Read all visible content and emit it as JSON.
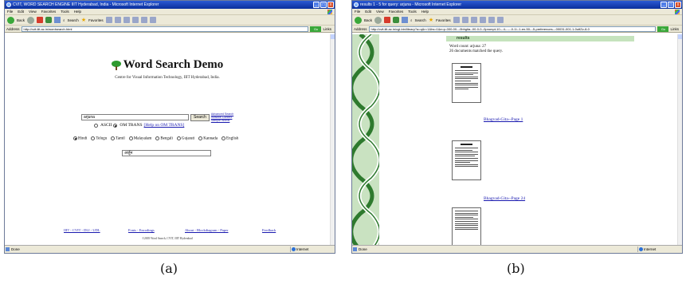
{
  "window_a": {
    "title": "CVIT, WORD SEARCH ENGINE IIIT Hyderabad, India - Microsoft Internet Explorer",
    "menu": [
      "File",
      "Edit",
      "View",
      "Favorites",
      "Tools",
      "Help"
    ],
    "toolbar": {
      "back": "Back",
      "search": "Search",
      "favorites": "Favorites"
    },
    "address_label": "Address",
    "address": "http://cvit.iiit.ac.in/wordsearch.html",
    "go": "Go",
    "links": "Links",
    "page": {
      "title": "Word Search Demo",
      "subtitle": "Centre for Visual Information Technology, IIIT Hyderabad, India.",
      "query_value": "arjuna",
      "search_button": "Search",
      "side_links": [
        "Advanced Search",
        "Invisible Content",
        "Sample Words"
      ],
      "encoding_options": [
        "ASCII",
        "OM TRANS"
      ],
      "encoding_selected": "OM TRANS",
      "help_link": "[Help on OM TRANS]",
      "languages": [
        "Hindi",
        "Telugu",
        "Tamil",
        "Malayalam",
        "Bengali",
        "Gujarati",
        "Kannada",
        "English"
      ],
      "language_selected": "Hindi",
      "transliterated_value": "अर्जुन",
      "footer_links": {
        "group1": "IIIT - CVIT - DLI - UDL",
        "group2": "Fonts - Encodings",
        "group3": "About - Blockdiagram - Paper",
        "group4": "Feedback"
      },
      "copyright": "©2005 Word Search, CVIT, IIIT Hyderabad"
    },
    "status": "Done",
    "zone": "Internet"
  },
  "window_b": {
    "title": "results 1 - 5 for query: arjuna - Microsoft Internet Explorer",
    "menu": [
      "File",
      "Edit",
      "View",
      "Favorites",
      "Tools",
      "Help"
    ],
    "toolbar": {
      "back": "Back",
      "search": "Search",
      "favorites": "Favorites"
    },
    "address_label": "Address",
    "address": "http://cvit.iiit.ac.in/cgi-bin/library?a=q&r=1&hs=1&e=p-000-00---0bhgita--00-0-0--0prompt-10---4------0-1l--1-en-50---5-preferences---00031-001-1-0utfZz-8-0",
    "go": "Go",
    "links": "Links",
    "page": {
      "header": "results",
      "word_count": "Word count: arjuna: 27",
      "match_count": "26 documents matched the query.",
      "results": [
        {
          "link": "Bhagvad-Gita--Page 1",
          "thumb_heading": "Chapter IV"
        },
        {
          "link": "Bhagvad-Gita--Page 24",
          "thumb_heading": "Chapter XVIII"
        },
        {
          "link": "",
          "thumb_heading": ""
        }
      ]
    },
    "status": "Done",
    "zone": "Internet"
  },
  "captions": {
    "a": "(a)",
    "b": "(b)"
  }
}
